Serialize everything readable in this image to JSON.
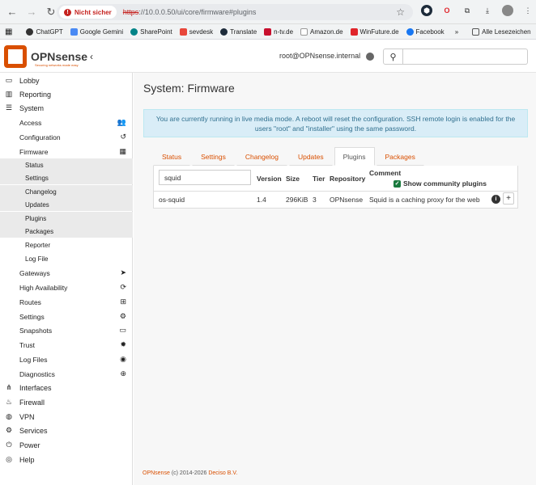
{
  "browser": {
    "security_label": "Nicht sicher",
    "url_scheme": "https",
    "url_rest": "://10.0.0.50/ui/core/firmware#plugins",
    "bookmarks": [
      "ChatGPT",
      "Google Gemini",
      "SharePoint",
      "sevdesk",
      "Translate",
      "n-tv.de",
      "Amazon.de",
      "WinFuture.de",
      "Facebook"
    ],
    "more_label": "»",
    "all_bookmarks": "Alle Lesezeichen"
  },
  "header": {
    "logo_text": "OPNsense",
    "logo_tagline": "Securing networks made easy",
    "user": "root@OPNsense.internal"
  },
  "sidebar": {
    "top": [
      {
        "label": "Lobby",
        "icon": "laptop-icon"
      },
      {
        "label": "Reporting",
        "icon": "chart-icon"
      },
      {
        "label": "System",
        "icon": "server-icon"
      }
    ],
    "system_children": [
      {
        "label": "Access",
        "icon": "users-icon"
      },
      {
        "label": "Configuration",
        "icon": "history-icon"
      },
      {
        "label": "Firmware",
        "icon": "building-icon"
      }
    ],
    "firmware_children": [
      "Status",
      "Settings",
      "Changelog",
      "Updates",
      "Plugins",
      "Packages",
      "Reporter",
      "Log File"
    ],
    "system_more": [
      {
        "label": "Gateways",
        "icon": "location-arrow-icon"
      },
      {
        "label": "High Availability",
        "icon": "refresh-icon"
      },
      {
        "label": "Routes",
        "icon": "map-signs-icon"
      },
      {
        "label": "Settings",
        "icon": "cogs-icon"
      },
      {
        "label": "Snapshots",
        "icon": "hdd-icon"
      },
      {
        "label": "Trust",
        "icon": "certificate-icon"
      },
      {
        "label": "Log Files",
        "icon": "eye-icon"
      },
      {
        "label": "Diagnostics",
        "icon": "medkit-icon"
      }
    ],
    "bottom": [
      {
        "label": "Interfaces",
        "icon": "sitemap-icon"
      },
      {
        "label": "Firewall",
        "icon": "fire-icon"
      },
      {
        "label": "VPN",
        "icon": "globe-icon"
      },
      {
        "label": "Services",
        "icon": "cog-icon"
      },
      {
        "label": "Power",
        "icon": "plug-icon"
      },
      {
        "label": "Help",
        "icon": "life-ring-icon"
      }
    ]
  },
  "main": {
    "title": "System: Firmware",
    "alert_line1": "You are currently running in live media mode. A reboot will reset the configuration. SSH remote login is enabled for the",
    "alert_line2": "users \"root\" and \"installer\" using the same password.",
    "tabs": [
      "Status",
      "Settings",
      "Changelog",
      "Updates",
      "Plugins",
      "Packages"
    ],
    "active_tab": "Plugins",
    "filter_value": "squid",
    "columns": {
      "version": "Version",
      "size": "Size",
      "tier": "Tier",
      "repository": "Repository",
      "comment": "Comment"
    },
    "community_label": "Show community plugins",
    "row": {
      "name": "os-squid",
      "version": "1.4",
      "size": "296KiB",
      "tier": "3",
      "repository": "OPNsense",
      "comment": "Squid is a caching proxy for the web"
    }
  },
  "footer": {
    "brand": "OPNsense",
    "copyright": "(c) 2014-2026",
    "company": "Deciso B.V."
  }
}
